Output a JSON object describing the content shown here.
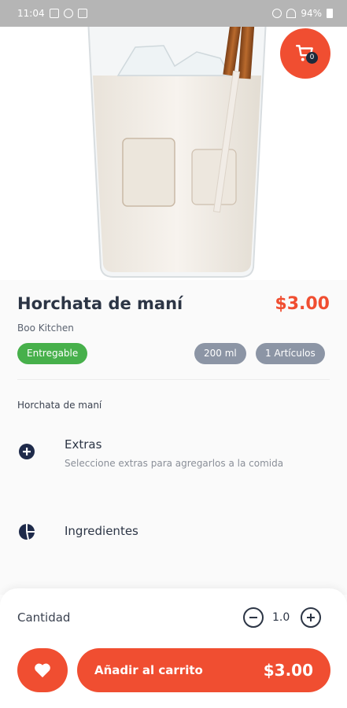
{
  "status_bar": {
    "time": "11:04",
    "battery": "94%"
  },
  "header": {
    "cart_count": "0"
  },
  "product": {
    "name": "Horchata de maní",
    "price": "$3.00",
    "restaurant": "Boo Kitchen",
    "badge": "Entregable",
    "size_chip": "200 ml",
    "items_chip": "1 Artículos",
    "description": "Horchata de maní"
  },
  "options": [
    {
      "title": "Extras",
      "subtitle": "Seleccione extras para agregarlos a la comida",
      "icon": "plus-circle-icon"
    },
    {
      "title": "Ingredientes",
      "subtitle": "",
      "icon": "pie-chart-icon"
    }
  ],
  "bottom_bar": {
    "quantity_label": "Cantidad",
    "quantity_value": "1.0",
    "add_label": "Añadir al carrito",
    "add_price": "$3.00"
  },
  "colors": {
    "accent": "#f04e31",
    "success": "#47b04b",
    "chip": "#8c95a5",
    "text": "#2c3545"
  }
}
